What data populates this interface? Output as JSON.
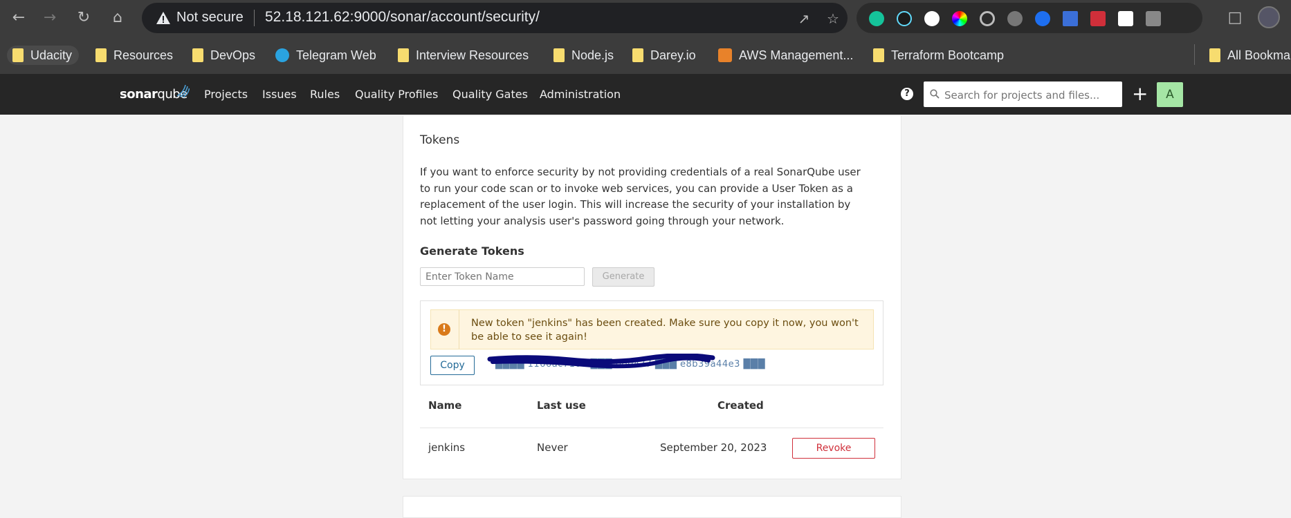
{
  "browser": {
    "security_label": "Not secure",
    "url": "52.18.121.62:9000/sonar/account/security/",
    "bookmarks": [
      {
        "label": "Udacity"
      },
      {
        "label": "Resources"
      },
      {
        "label": "DevOps"
      },
      {
        "label": "Telegram Web"
      },
      {
        "label": "Interview Resources"
      },
      {
        "label": "Node.js"
      },
      {
        "label": "Darey.io"
      },
      {
        "label": "AWS Management..."
      },
      {
        "label": "Terraform Bootcamp"
      },
      {
        "label": "All Bookma"
      }
    ]
  },
  "header": {
    "logo_bold": "sonar",
    "logo_light": "qube",
    "nav": [
      "Projects",
      "Issues",
      "Rules",
      "Quality Profiles",
      "Quality Gates",
      "Administration"
    ],
    "help": "?",
    "search_placeholder": "Search for projects and files...",
    "add": "+",
    "avatar_letter": "A",
    "accent": "#262626"
  },
  "tokens": {
    "title": "Tokens",
    "description": "If you want to enforce security by not providing credentials of a real SonarQube user to run your code scan or to invoke web services, you can provide a User Token as a replacement of the user login. This will increase the security of your installation by not letting your analysis user's password going through your network.",
    "generate_heading": "Generate Tokens",
    "name_placeholder": "Enter Token Name",
    "generate_button": "Generate",
    "alert_text": "New token \"jenkins\" has been created. Make sure you copy it now, you won't be able to see it again!",
    "copy_button": "Copy",
    "token_value": "████ 1166ac7100 ███ b00477 ███ e8b39a44e3 ███",
    "table": {
      "headers": [
        "Name",
        "Last use",
        "Created"
      ],
      "rows": [
        {
          "name": "jenkins",
          "last_use": "Never",
          "created": "September 20, 2023",
          "action": "Revoke"
        }
      ]
    }
  }
}
